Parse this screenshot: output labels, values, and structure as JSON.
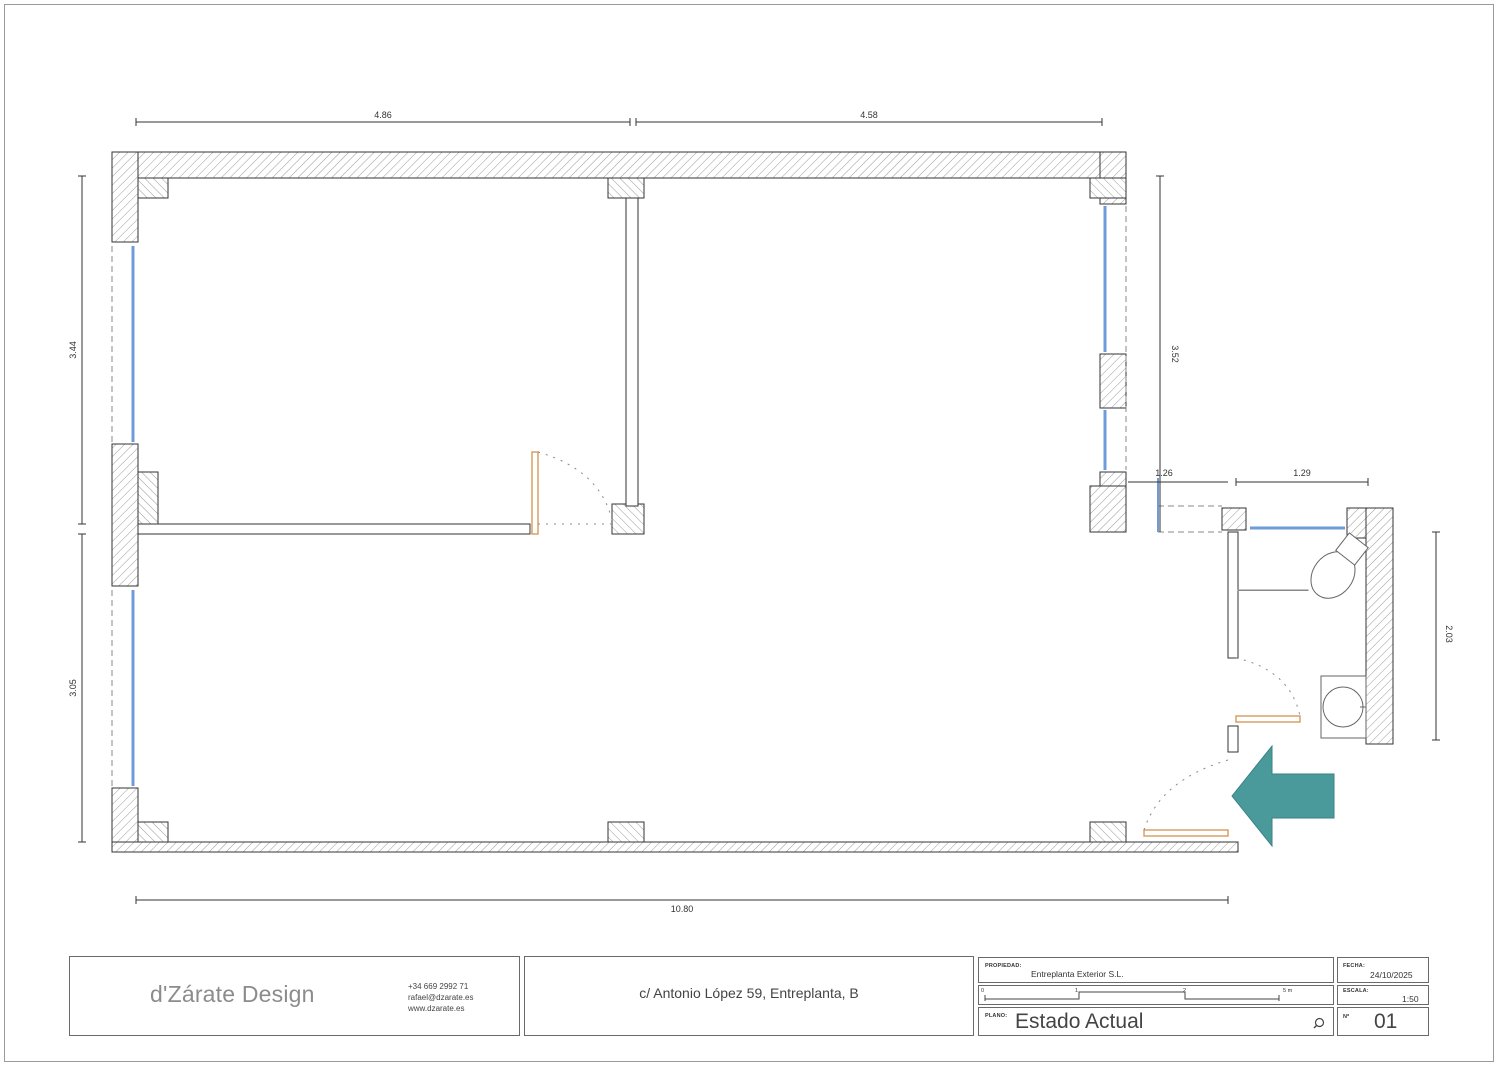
{
  "floor_plan": {
    "dimensions": {
      "top_left": "4.86",
      "top_right": "4.58",
      "left_upper": "3.44",
      "left_lower": "3.05",
      "right_upper": "3.52",
      "corridor_gap": "1.26",
      "bathroom_width": "1.29",
      "bathroom_height": "2.03",
      "bottom_total": "10.80"
    },
    "entrance_arrow_color": "#4a9a9c",
    "window_color": "#6f9bd8",
    "door_color": "#d9a066"
  },
  "title_block": {
    "studio_name": "d'Zárate Design",
    "contact_lines": [
      "+34 669 2992 71",
      "rafael@dzarate.es",
      "www.dzarate.es"
    ],
    "address": "c/ Antonio López 59, Entreplanta, B",
    "propiedad_label": "PROPIEDAD:",
    "propiedad_value": "Entreplanta Exterior S.L.",
    "scale_bar_labels": [
      "0",
      "1",
      "2",
      "5 m"
    ],
    "plano_label": "PLANO:",
    "plano_value": "Estado Actual",
    "fecha_label": "FECHA:",
    "fecha_value": "24/10/2025",
    "escala_label": "ESCALA:",
    "escala_value": "1:50",
    "numero_label": "Nº",
    "numero_value": "01",
    "search_icon": "magnifier-icon"
  }
}
